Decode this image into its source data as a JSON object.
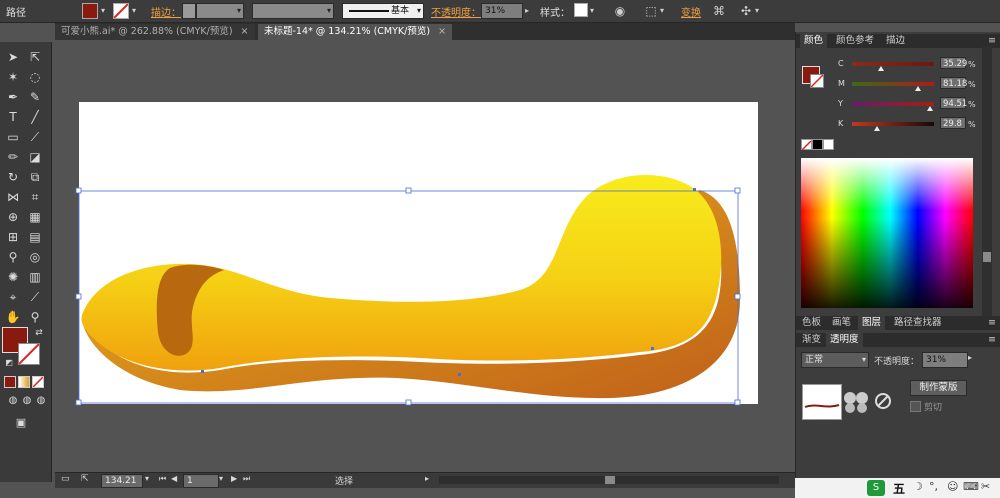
{
  "control_bar": {
    "object_type": "路径",
    "stroke_label": "描边：",
    "stroke_profile": "基本",
    "opacity_label": "不透明度：",
    "opacity_value": "31%",
    "style_label": "样式：",
    "transform_label": "变换",
    "fill_color": "#8b1a0e"
  },
  "tabs": [
    {
      "label": "可爱小熊.ai* @ 262.88% (CMYK/预览)",
      "active": false
    },
    {
      "label": "未标题-14* @ 134.21% (CMYK/预览)",
      "active": true
    }
  ],
  "tab_close": "×",
  "color_panel": {
    "tabs": [
      "颜色",
      "颜色参考",
      "描边"
    ],
    "channels": [
      {
        "name": "C",
        "value": "35.29",
        "position": 0.35
      },
      {
        "name": "M",
        "value": "81.18",
        "position": 0.81
      },
      {
        "name": "Y",
        "value": "94.51",
        "position": 0.95
      },
      {
        "name": "K",
        "value": "29.8",
        "position": 0.3
      }
    ],
    "unit": "%",
    "current_color": "#8b1a0e"
  },
  "lower_panel": {
    "tabs": [
      "色板",
      "画笔",
      "图层",
      "路径查找器"
    ],
    "sub_tabs": [
      "渐变",
      "透明度"
    ],
    "blend_mode": "正常",
    "opacity_label": "不透明度：",
    "opacity_value": "31%",
    "make_mask_button": "制作蒙版",
    "clip_label": "剪切"
  },
  "status_bar": {
    "zoom": "134.21",
    "page": "1",
    "tool_name": "选择"
  },
  "taskbar": {
    "ime_label": "五"
  },
  "colors": {
    "shape_light": "#f6e81a",
    "shape_mid": "#f1b511",
    "shape_dark": "#c7661a",
    "selection": "#4a6fd6"
  }
}
